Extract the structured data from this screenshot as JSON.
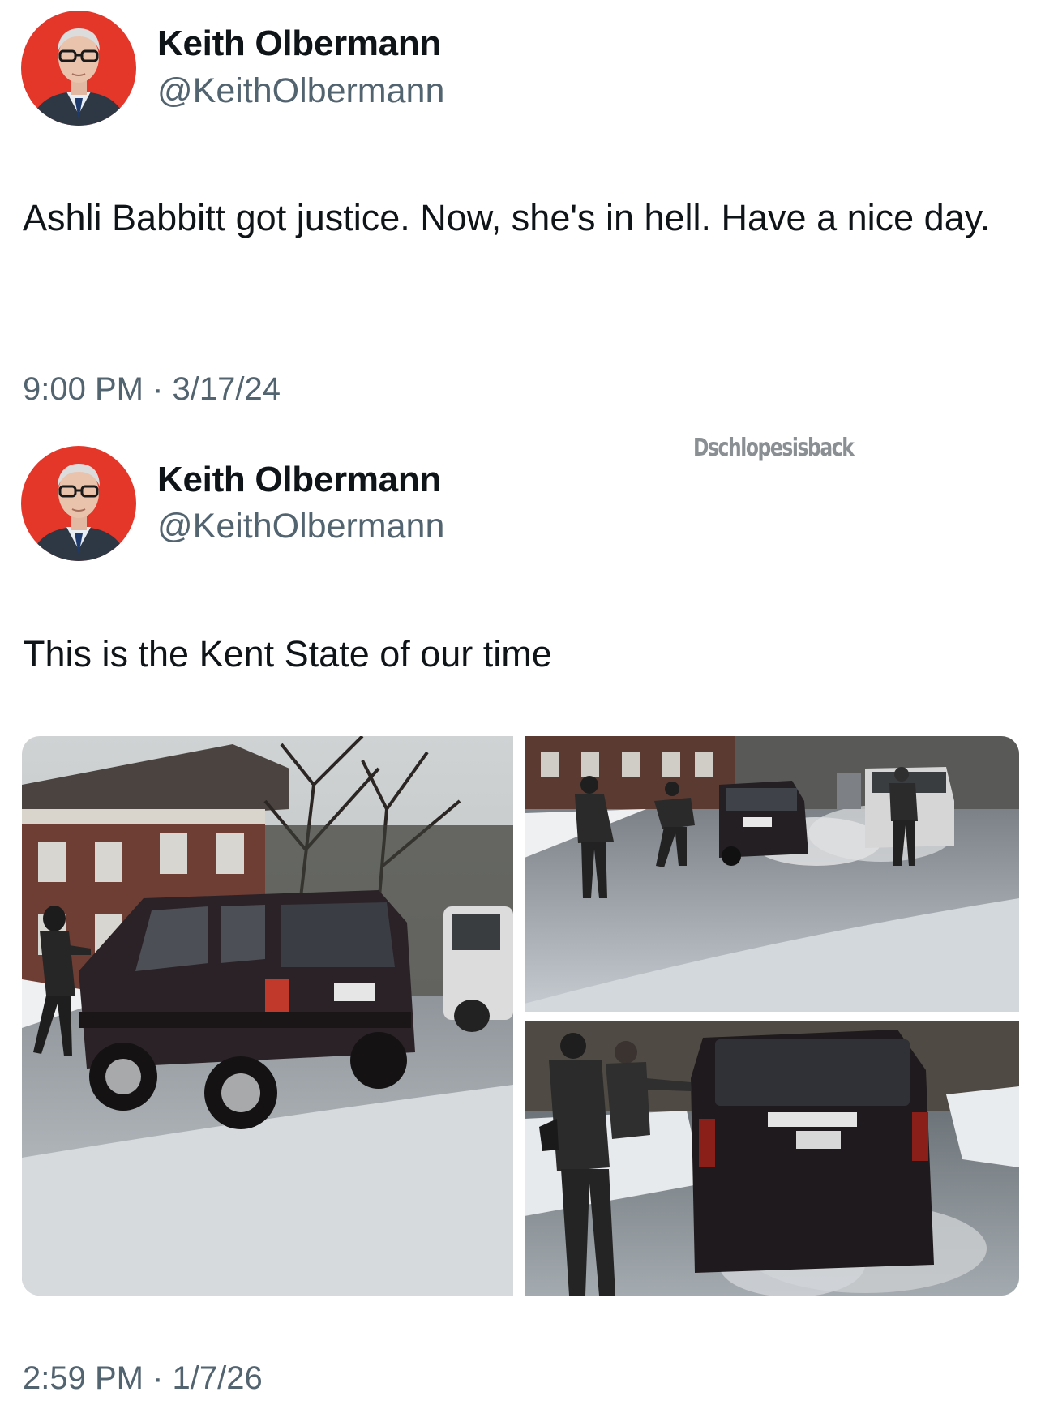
{
  "tweets": [
    {
      "author": {
        "name": "Keith Olbermann",
        "handle": "@KeithOlbermann"
      },
      "text": "Ashli Babbitt got justice. Now, she's in hell. Have a nice day.",
      "timestamp": "9:00 PM · 3/17/24"
    },
    {
      "author": {
        "name": "Keith Olbermann",
        "handle": "@KeithOlbermann"
      },
      "text": "This is the Kent State of our time",
      "timestamp": "2:59 PM · 1/7/26"
    }
  ],
  "watermark": "Dschlopesisback",
  "colors": {
    "avatar_bg": "#e5362a",
    "text_primary": "#0f1419",
    "text_secondary": "#536471"
  }
}
